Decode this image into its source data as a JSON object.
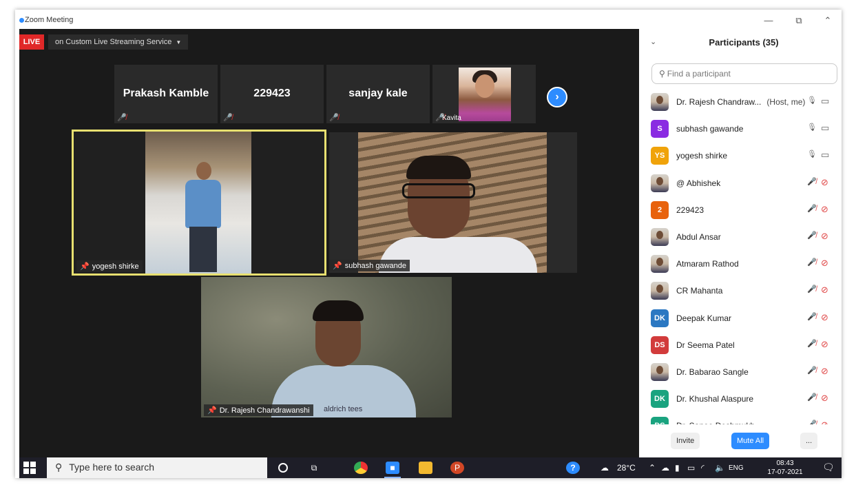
{
  "window": {
    "title": "Zoom Meeting",
    "controls": {
      "minimize": "—",
      "restore": "⧉",
      "collapse": "⌃"
    }
  },
  "meeting": {
    "live_badge": "LIVE",
    "stream_label": "on Custom Live Streaming Service",
    "thumbnails": [
      {
        "name": "Prakash Kamble"
      },
      {
        "name": "229423"
      },
      {
        "name": "sanjay kale"
      },
      {
        "name": "Kavita"
      }
    ],
    "tiles": {
      "yogesh": "yogesh shirke",
      "subhash": "subhash gawande",
      "rajesh": "Dr. Rajesh Chandrawanshi",
      "rajesh_shirt_print": "aldrich tees"
    },
    "next_page_icon": "›"
  },
  "participants_panel": {
    "title": "Participants (35)",
    "search_placeholder": "Find a participant",
    "participants": [
      {
        "name": "Dr. Rajesh Chandraw...",
        "tag": "(Host, me)",
        "avatar": "",
        "avatar_color": "photo",
        "mic": "on",
        "cam": "on"
      },
      {
        "name": "subhash gawande",
        "tag": "",
        "avatar": "S",
        "avatar_color": "#8a2be2",
        "mic": "on",
        "cam": "on"
      },
      {
        "name": "yogesh shirke",
        "tag": "",
        "avatar": "YS",
        "avatar_color": "#f0a30a",
        "mic": "on",
        "cam": "on"
      },
      {
        "name": "@ Abhishek",
        "tag": "",
        "avatar": "",
        "avatar_color": "photo",
        "mic": "off",
        "cam": "off"
      },
      {
        "name": "229423",
        "tag": "",
        "avatar": "2",
        "avatar_color": "#e8620c",
        "mic": "off",
        "cam": "off"
      },
      {
        "name": "Abdul Ansar",
        "tag": "",
        "avatar": "",
        "avatar_color": "photo",
        "mic": "off",
        "cam": "off"
      },
      {
        "name": "Atmaram Rathod",
        "tag": "",
        "avatar": "",
        "avatar_color": "photo",
        "mic": "off",
        "cam": "off"
      },
      {
        "name": "CR Mahanta",
        "tag": "",
        "avatar": "",
        "avatar_color": "photo",
        "mic": "off",
        "cam": "off"
      },
      {
        "name": "Deepak Kumar",
        "tag": "",
        "avatar": "DK",
        "avatar_color": "#2b78c2",
        "mic": "off",
        "cam": "off"
      },
      {
        "name": "Dr Seema Patel",
        "tag": "",
        "avatar": "DS",
        "avatar_color": "#d23b3b",
        "mic": "off",
        "cam": "off"
      },
      {
        "name": "Dr. Babarao Sangle",
        "tag": "",
        "avatar": "",
        "avatar_color": "photo",
        "mic": "off",
        "cam": "off"
      },
      {
        "name": "Dr. Khushal Alaspure",
        "tag": "",
        "avatar": "DK",
        "avatar_color": "#1aa37f",
        "mic": "off",
        "cam": "off"
      },
      {
        "name": "Dr. Sanee Deshmukh",
        "tag": "",
        "avatar": "DS",
        "avatar_color": "#1aa37f",
        "mic": "off",
        "cam": "off"
      }
    ],
    "footer": {
      "invite": "Invite",
      "mute_all": "Mute All",
      "more": "..."
    }
  },
  "taskbar": {
    "search_placeholder": "Type here to search",
    "temperature": "28°C",
    "language": "ENG",
    "time": "08:43",
    "date": "17-07-2021"
  },
  "colors": {
    "zoom_blue": "#2d8cff",
    "live_red": "#e02828",
    "muted_red": "#e04848",
    "active_speaker": "#e8e070"
  }
}
